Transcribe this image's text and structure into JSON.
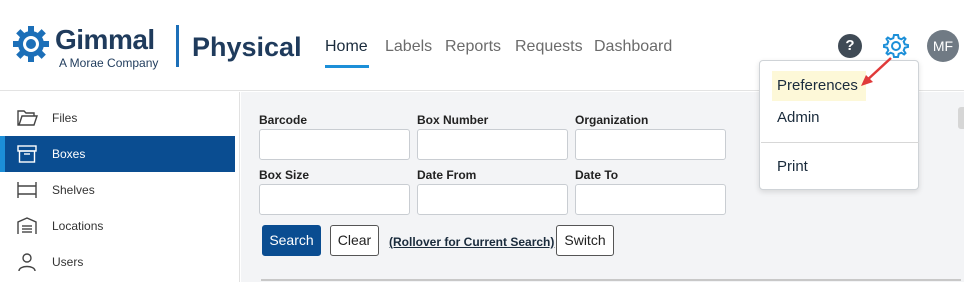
{
  "brand": {
    "logo_word": "Gimmal",
    "logo_sub": "A Morae Company",
    "product": "Physical",
    "accent": "#1c8fd8",
    "navy": "#0a4d91"
  },
  "nav": {
    "items": [
      {
        "label": "Home",
        "active": true
      },
      {
        "label": "Labels"
      },
      {
        "label": "Reports"
      },
      {
        "label": "Requests"
      },
      {
        "label": "Dashboard"
      }
    ]
  },
  "header_actions": {
    "help_icon": "question-circle-icon",
    "help_text": "?",
    "settings_icon": "gear-icon",
    "avatar_initials": "MF"
  },
  "sidebar": {
    "items": [
      {
        "label": "Files",
        "icon": "folder-icon"
      },
      {
        "label": "Boxes",
        "icon": "box-icon",
        "active": true
      },
      {
        "label": "Shelves",
        "icon": "shelves-icon"
      },
      {
        "label": "Locations",
        "icon": "warehouse-icon"
      },
      {
        "label": "Users",
        "icon": "user-icon"
      }
    ]
  },
  "search_form": {
    "fields": [
      {
        "label": "Barcode",
        "value": ""
      },
      {
        "label": "Box Number",
        "value": ""
      },
      {
        "label": "Organization",
        "value": ""
      },
      {
        "label": "Box Size",
        "value": ""
      },
      {
        "label": "Date From",
        "value": ""
      },
      {
        "label": "Date To",
        "value": ""
      }
    ],
    "search_label": "Search",
    "clear_label": "Clear",
    "rollover_label": "(Rollover for Current Search)",
    "switch_label": "Switch"
  },
  "settings_menu": {
    "items": [
      {
        "label": "Preferences",
        "highlighted": true
      },
      {
        "label": "Admin"
      },
      {
        "label": "Print"
      }
    ]
  }
}
